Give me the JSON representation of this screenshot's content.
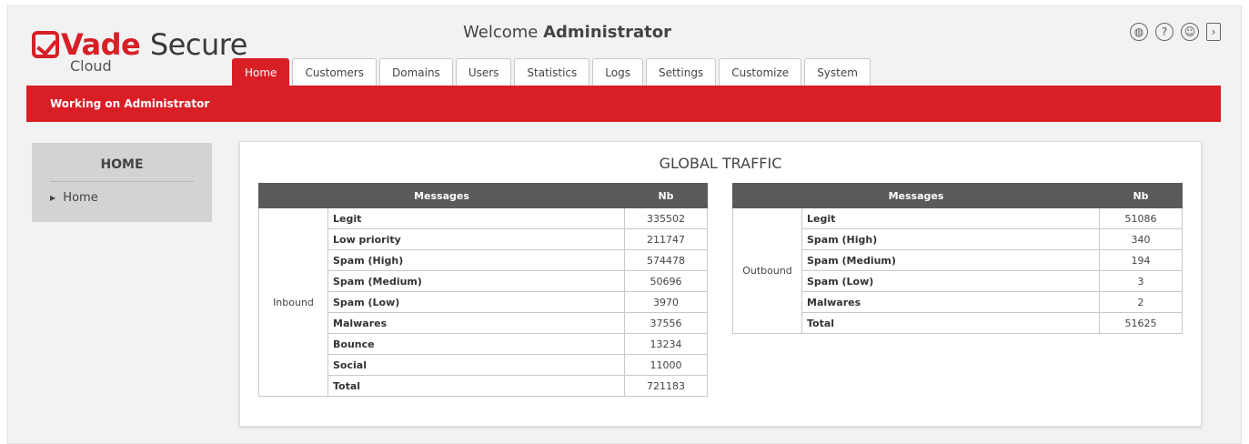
{
  "brand": {
    "vade": "Vade",
    "secure": "Secure",
    "cloud": "Cloud"
  },
  "header": {
    "welcome_prefix": "Welcome",
    "user": "Administrator"
  },
  "icons": [
    "globe-icon",
    "help-icon",
    "user-icon",
    "logout-icon"
  ],
  "tabs": [
    {
      "label": "Home",
      "active": true
    },
    {
      "label": "Customers"
    },
    {
      "label": "Domains"
    },
    {
      "label": "Users"
    },
    {
      "label": "Statistics"
    },
    {
      "label": "Logs"
    },
    {
      "label": "Settings"
    },
    {
      "label": "Customize"
    },
    {
      "label": "System"
    }
  ],
  "status_bar": "Working on Administrator",
  "sidenav": {
    "title": "HOME",
    "items": [
      "Home"
    ]
  },
  "panel": {
    "title": "GLOBAL TRAFFIC",
    "col_messages": "Messages",
    "col_nb": "Nb",
    "inbound": {
      "label": "Inbound",
      "rows": [
        {
          "label": "Legit",
          "value": "335502"
        },
        {
          "label": "Low priority",
          "value": "211747"
        },
        {
          "label": "Spam (High)",
          "value": "574478"
        },
        {
          "label": "Spam (Medium)",
          "value": "50696"
        },
        {
          "label": "Spam (Low)",
          "value": "3970"
        },
        {
          "label": "Malwares",
          "value": "37556"
        },
        {
          "label": "Bounce",
          "value": "13234"
        },
        {
          "label": "Social",
          "value": "11000"
        },
        {
          "label": "Total",
          "value": "721183"
        }
      ]
    },
    "outbound": {
      "label": "Outbound",
      "rows": [
        {
          "label": "Legit",
          "value": "51086"
        },
        {
          "label": "Spam (High)",
          "value": "340"
        },
        {
          "label": "Spam (Medium)",
          "value": "194"
        },
        {
          "label": "Spam (Low)",
          "value": "3"
        },
        {
          "label": "Malwares",
          "value": "2"
        },
        {
          "label": "Total",
          "value": "51625"
        }
      ]
    }
  },
  "colors": {
    "accent": "#d81f26",
    "header_dark": "#5a5a5a"
  }
}
